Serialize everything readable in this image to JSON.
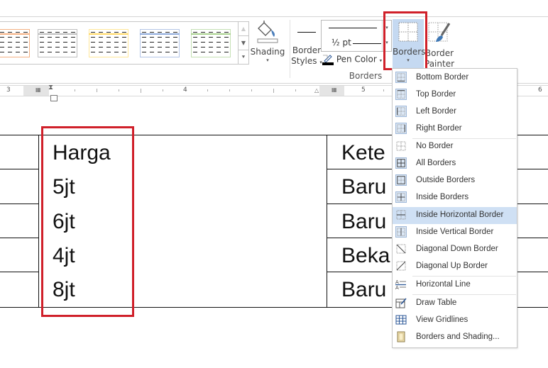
{
  "ribbon": {
    "table_style_gallery": {
      "styles": [
        {
          "name": "grid-table-orange",
          "accent": "#f4b183"
        },
        {
          "name": "grid-table-gray",
          "accent": "#bfbfbf"
        },
        {
          "name": "grid-table-gold",
          "accent": "#ffd966"
        },
        {
          "name": "grid-table-blue",
          "accent": "#8eaadb"
        },
        {
          "name": "grid-table-green",
          "accent": "#a9d18e"
        }
      ],
      "scroll_up": "▲",
      "scroll_down": "▼",
      "more": "⯆"
    },
    "shading": {
      "label": "Shading",
      "caret": "▾"
    },
    "border_styles": {
      "line1": "Border",
      "line2": "Styles",
      "caret": "▾"
    },
    "line_weight": {
      "value": "½ pt"
    },
    "pen_color": {
      "label": "Pen Color",
      "caret": "▾",
      "color": "#000000"
    },
    "borders_button": {
      "label": "Borders",
      "caret": "▾"
    },
    "border_painter": {
      "line1": "Border",
      "line2": "Painter"
    },
    "group_label": "Borders",
    "highlight_color": "#d0202a"
  },
  "ruler": {
    "numbers": [
      "3",
      "4",
      "5",
      "6"
    ]
  },
  "table": {
    "col_harga": [
      "Harga",
      "5jt",
      "6jt",
      "4jt",
      "8jt"
    ],
    "col_keterangan": [
      "Kete",
      "Baru",
      "Baru",
      "Beka",
      "Baru"
    ]
  },
  "borders_menu": {
    "items": [
      {
        "label": "Bottom Border",
        "icon": "bottom-border-icon"
      },
      {
        "label": "Top Border",
        "icon": "top-border-icon"
      },
      {
        "label": "Left Border",
        "icon": "left-border-icon"
      },
      {
        "label": "Right Border",
        "icon": "right-border-icon"
      },
      {
        "label": "No Border",
        "icon": "no-border-icon"
      },
      {
        "label": "All Borders",
        "icon": "all-borders-icon"
      },
      {
        "label": "Outside Borders",
        "icon": "outside-borders-icon"
      },
      {
        "label": "Inside Borders",
        "icon": "inside-borders-icon"
      },
      {
        "label": "Inside Horizontal Border",
        "icon": "inside-horizontal-border-icon",
        "highlighted": true
      },
      {
        "label": "Inside Vertical Border",
        "icon": "inside-vertical-border-icon"
      },
      {
        "label": "Diagonal Down Border",
        "icon": "diagonal-down-border-icon"
      },
      {
        "label": "Diagonal Up Border",
        "icon": "diagonal-up-border-icon"
      },
      {
        "label": "Horizontal Line",
        "icon": "horizontal-line-icon"
      },
      {
        "label": "Draw Table",
        "icon": "draw-table-icon"
      },
      {
        "label": "View Gridlines",
        "icon": "view-gridlines-icon"
      },
      {
        "label": "Borders and Shading...",
        "icon": "borders-and-shading-icon"
      }
    ]
  }
}
